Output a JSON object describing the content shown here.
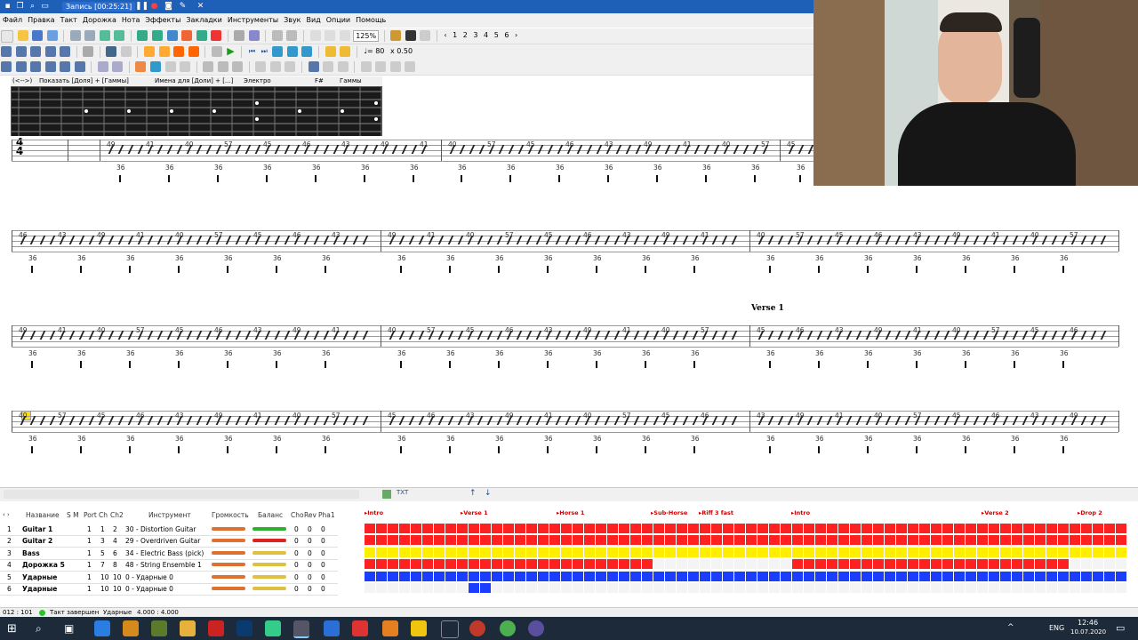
{
  "titlebar": {
    "recording": "Запись [00:25:21]"
  },
  "menu": [
    "Файл",
    "Правка",
    "Такт",
    "Дорожка",
    "Нота",
    "Эффекты",
    "Закладки",
    "Инструменты",
    "Звук",
    "Вид",
    "Опции",
    "Помощь"
  ],
  "toolbar": {
    "zoom": "125%",
    "pages": [
      "1",
      "2",
      "3",
      "4",
      "5",
      "6"
    ],
    "tempo": "♩= 80",
    "speed": "x 0.50"
  },
  "fret_toolbar": {
    "show": "Показать [Доля] + [Гаммы]",
    "names": "Имена для [Доли] + [...]",
    "mode": "Электро",
    "arrow": "(<-->)",
    "key": "F#",
    "scales": "Гаммы"
  },
  "score": {
    "section_label": "Verse 1",
    "time_signature": "4/4"
  },
  "track_header": {
    "name": "Название",
    "sm": "S M",
    "port": "Port",
    "ch": "Ch",
    "ch2": "Ch2",
    "instrument": "Инструмент",
    "volume": "Громкость",
    "balance": "Баланс",
    "cho": "Cho",
    "rev": "Rev",
    "pha": "Pha",
    "one": "1"
  },
  "tracks": [
    {
      "num": "1",
      "name": "Guitar 1",
      "port": "1",
      "ch": "1",
      "ch2": "2",
      "instrument": "30 - Distortion Guitar",
      "cho": "0",
      "rev": "0",
      "pha": "0"
    },
    {
      "num": "2",
      "name": "Guitar 2",
      "port": "1",
      "ch": "3",
      "ch2": "4",
      "instrument": "29 - Overdriven Guitar",
      "cho": "0",
      "rev": "0",
      "pha": "0"
    },
    {
      "num": "3",
      "name": "Bass",
      "port": "1",
      "ch": "5",
      "ch2": "6",
      "instrument": "34 - Electric Bass (pick)",
      "cho": "0",
      "rev": "0",
      "pha": "0"
    },
    {
      "num": "4",
      "name": "Дорожка 5",
      "port": "1",
      "ch": "7",
      "ch2": "8",
      "instrument": "48 - String Ensemble 1",
      "cho": "0",
      "rev": "0",
      "pha": "0"
    },
    {
      "num": "5",
      "name": "Ударные",
      "port": "1",
      "ch": "10",
      "ch2": "10",
      "instrument": "0 - Ударные 0",
      "cho": "0",
      "rev": "0",
      "pha": "0"
    },
    {
      "num": "6",
      "name": "Ударные",
      "port": "1",
      "ch": "10",
      "ch2": "10",
      "instrument": "0 - Ударные 0",
      "cho": "0",
      "rev": "0",
      "pha": "0"
    }
  ],
  "markers": [
    "Intro",
    "Verse 1",
    "Horse 1",
    "Sub-Horse",
    "Riff 3 fast",
    "Intro",
    "Verse 2",
    "Drop 2"
  ],
  "colors": {
    "red": "#ff2020",
    "yellow": "#ffee00",
    "blue": "#1a3dff",
    "titlebar": "#1e5fb8"
  },
  "status": {
    "position": "012 : 101",
    "state": "Такт завершен",
    "track": "Ударные",
    "time": "4.000 : 4.000"
  },
  "taskbar": {
    "lang": "ENG",
    "time": "12:46",
    "date": "10.07.2020"
  }
}
